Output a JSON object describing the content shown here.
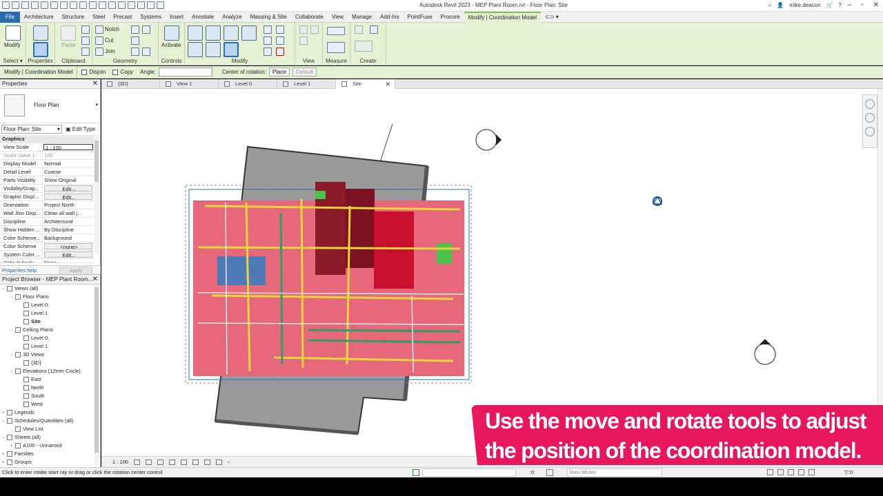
{
  "app": {
    "title": "Autodesk Revit 2023 - MEP Plant Room.rvt - Floor Plan: Site",
    "user": "mike.deacon"
  },
  "ribbon_tabs": [
    "File",
    "Architecture",
    "Structure",
    "Steel",
    "Precast",
    "Systems",
    "Insert",
    "Annotate",
    "Analyze",
    "Massing & Site",
    "Collaborate",
    "View",
    "Manage",
    "Add-Ins",
    "PointFuse",
    "Procore",
    "Modify | Coordination Model"
  ],
  "ribbon": {
    "modify_label": "Modify",
    "paste_label": "Paste",
    "notch_label": "Notch",
    "cut_label": "Cut",
    "join_label": "Join",
    "activate_label": "Activate",
    "groups": [
      "Select",
      "Properties",
      "Clipboard",
      "Geometry",
      "Controls",
      "Modify",
      "View",
      "Measure",
      "Create"
    ]
  },
  "options_bar": {
    "context": "Modify | Coordination Model",
    "disjoin_label": "Disjoin",
    "copy_label": "Copy",
    "angle_label": "Angle:",
    "center_label": "Center of rotation:",
    "place_label": "Place",
    "default_label": "Default"
  },
  "properties": {
    "title": "Properties",
    "type_name": "Floor Plan",
    "instance_selector": "Floor Plan: Site",
    "edit_type_label": "Edit Type",
    "section": "Graphics",
    "rows": [
      {
        "k": "View Scale",
        "v": "1 : 100"
      },
      {
        "k": "Scale Value   1:",
        "v": "100"
      },
      {
        "k": "Display Model",
        "v": "Normal"
      },
      {
        "k": "Detail Level",
        "v": "Coarse"
      },
      {
        "k": "Parts Visibility",
        "v": "Show Original"
      },
      {
        "k": "Visibility/Grap...",
        "v": "Edit..."
      },
      {
        "k": "Graphic Displ...",
        "v": "Edit..."
      },
      {
        "k": "Orientation",
        "v": "Project North"
      },
      {
        "k": "Wall Join Disp...",
        "v": "Clean all wall j..."
      },
      {
        "k": "Discipline",
        "v": "Architectural"
      },
      {
        "k": "Show Hidden ...",
        "v": "By Discipline"
      },
      {
        "k": "Color Scheme...",
        "v": "Background"
      },
      {
        "k": "Color Scheme",
        "v": "<none>"
      },
      {
        "k": "System Color ...",
        "v": "Edit..."
      },
      {
        "k": "Default Analy...",
        "v": "None"
      }
    ],
    "help_label": "Properties help",
    "apply_label": "Apply"
  },
  "browser": {
    "title": "Project Browser - MEP Plant Room...",
    "items": [
      {
        "label": "Views (all)",
        "level": 0,
        "exp": "−"
      },
      {
        "label": "Floor Plans",
        "level": 1,
        "exp": "−"
      },
      {
        "label": "Level 0",
        "level": 2,
        "exp": ""
      },
      {
        "label": "Level 1",
        "level": 2,
        "exp": ""
      },
      {
        "label": "Site",
        "level": 2,
        "exp": "",
        "bold": true
      },
      {
        "label": "Ceiling Plans",
        "level": 1,
        "exp": "−"
      },
      {
        "label": "Level 0",
        "level": 2,
        "exp": ""
      },
      {
        "label": "Level 1",
        "level": 2,
        "exp": ""
      },
      {
        "label": "3D Views",
        "level": 1,
        "exp": "−"
      },
      {
        "label": "{3D}",
        "level": 2,
        "exp": ""
      },
      {
        "label": "Elevations (12mm Circle)",
        "level": 1,
        "exp": "−"
      },
      {
        "label": "East",
        "level": 2,
        "exp": ""
      },
      {
        "label": "North",
        "level": 2,
        "exp": ""
      },
      {
        "label": "South",
        "level": 2,
        "exp": ""
      },
      {
        "label": "West",
        "level": 2,
        "exp": ""
      },
      {
        "label": "Legends",
        "level": 0,
        "exp": "+"
      },
      {
        "label": "Schedules/Quantities (all)",
        "level": 0,
        "exp": "−"
      },
      {
        "label": "View List",
        "level": 1,
        "exp": ""
      },
      {
        "label": "Sheets (all)",
        "level": 0,
        "exp": "−"
      },
      {
        "label": "A100 - Unnamed",
        "level": 1,
        "exp": "+"
      },
      {
        "label": "Families",
        "level": 0,
        "exp": "+"
      },
      {
        "label": "Groups",
        "level": 0,
        "exp": "+"
      }
    ]
  },
  "view_tabs": [
    "{3D}",
    "View 1",
    "Level 0",
    "Level 1",
    "Site"
  ],
  "view_control": {
    "scale": "1 : 100"
  },
  "status": {
    "message": "Click to enter rotate start ray or drag or click the rotation center control",
    "zero": ":0",
    "model": "Main Model",
    "zero2": "▽:0"
  },
  "caption": {
    "line1": "Use the move and rotate tools to adjust",
    "line2": "the position of the coordination model."
  }
}
